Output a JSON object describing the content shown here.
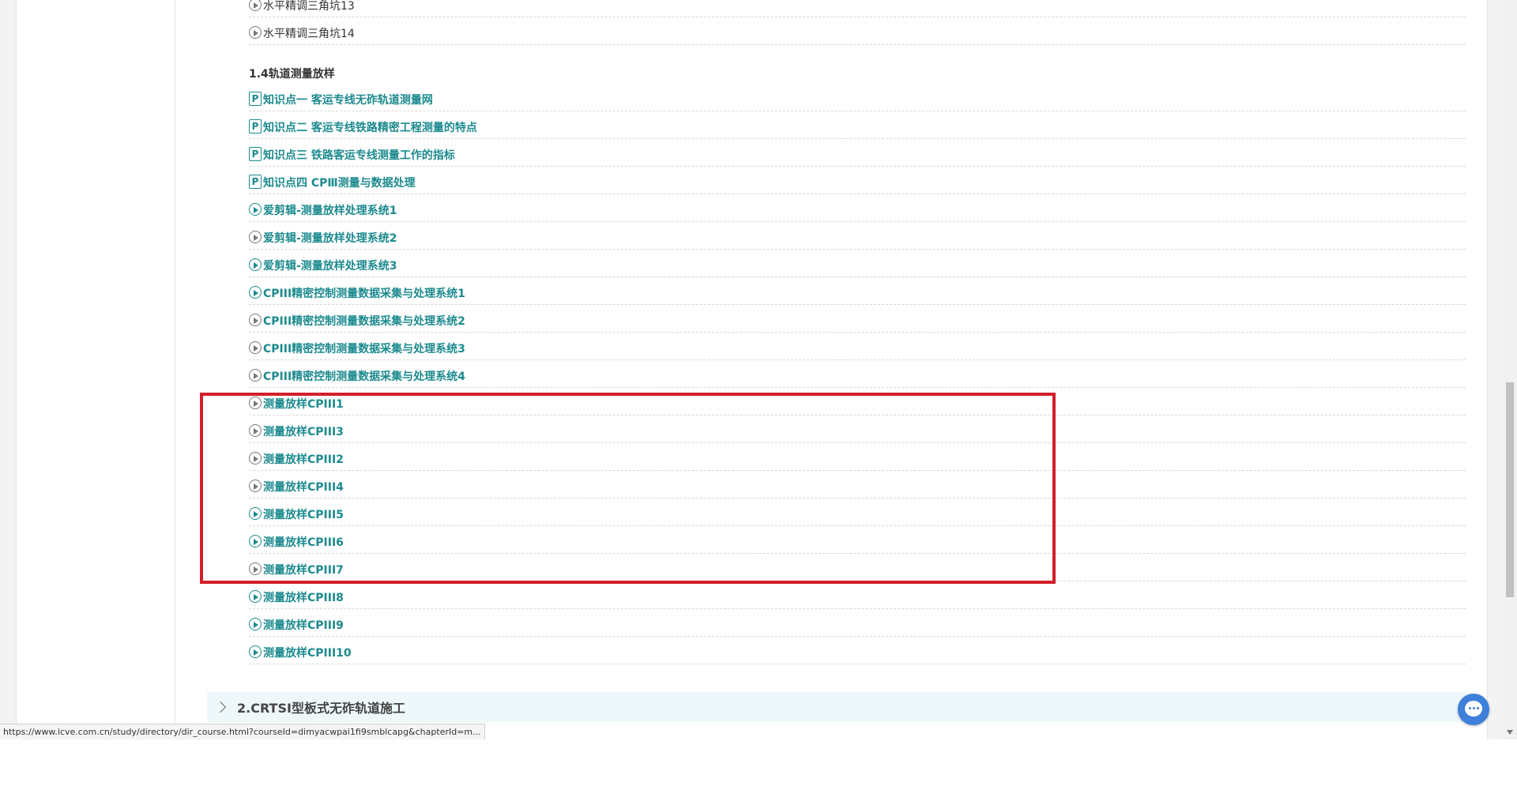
{
  "rows_top": [
    {
      "label": "水平精调三角坑13",
      "icon": "play-circle-icon",
      "style": "plain"
    },
    {
      "label": "水平精调三角坑14",
      "icon": "play-circle-icon",
      "style": "plain"
    }
  ],
  "section": {
    "title": "1.4轨道测量放样"
  },
  "items": [
    {
      "label": "知识点一 客运专线无砟轨道测量网",
      "icon": "ppt-icon"
    },
    {
      "label": "知识点二 客运专线铁路精密工程测量的特点",
      "icon": "ppt-icon"
    },
    {
      "label": "知识点三 铁路客运专线测量工作的指标",
      "icon": "ppt-icon"
    },
    {
      "label": "知识点四 CPⅢ测量与数据处理",
      "icon": "ppt-icon"
    },
    {
      "label": "爱剪辑-测量放样处理系统1",
      "icon": "play-circle-icon"
    },
    {
      "label": "爱剪辑-测量放样处理系统2",
      "icon": "play-circle-icon"
    },
    {
      "label": "爱剪辑-测量放样处理系统3",
      "icon": "play-circle-icon"
    },
    {
      "label": "CPIII精密控制测量数据采集与处理系统1",
      "icon": "play-circle-icon"
    },
    {
      "label": "CPIII精密控制测量数据采集与处理系统2",
      "icon": "play-circle-icon"
    },
    {
      "label": "CPIII精密控制测量数据采集与处理系统3",
      "icon": "play-circle-icon"
    },
    {
      "label": "CPIII精密控制测量数据采集与处理系统4",
      "icon": "play-circle-icon"
    },
    {
      "label": "测量放样CPIII1",
      "icon": "play-circle-icon"
    },
    {
      "label": "测量放样CPIII3",
      "icon": "play-circle-icon"
    },
    {
      "label": "测量放样CPIII2",
      "icon": "play-circle-icon"
    },
    {
      "label": "测量放样CPIII4",
      "icon": "play-circle-icon"
    },
    {
      "label": "测量放样CPIII5",
      "icon": "play-circle-icon"
    },
    {
      "label": "测量放样CPIII6",
      "icon": "play-circle-icon"
    },
    {
      "label": "测量放样CPIII7",
      "icon": "play-circle-icon"
    },
    {
      "label": "测量放样CPIII8",
      "icon": "play-circle-icon"
    },
    {
      "label": "测量放样CPIII9",
      "icon": "play-circle-icon"
    },
    {
      "label": "测量放样CPIII10",
      "icon": "play-circle-icon"
    }
  ],
  "chapter": {
    "label": "2.CRTSI型板式无砟轨道施工"
  },
  "status_bar": {
    "url": "https://www.icve.com.cn/study/directory/dir_course.html?courseId=dimyacwpai1fi9smblcapg&chapterId=m..."
  },
  "colors": {
    "link": "#1c8a8e",
    "highlight": "#d11f2a",
    "chat": "#3d7fd9"
  }
}
